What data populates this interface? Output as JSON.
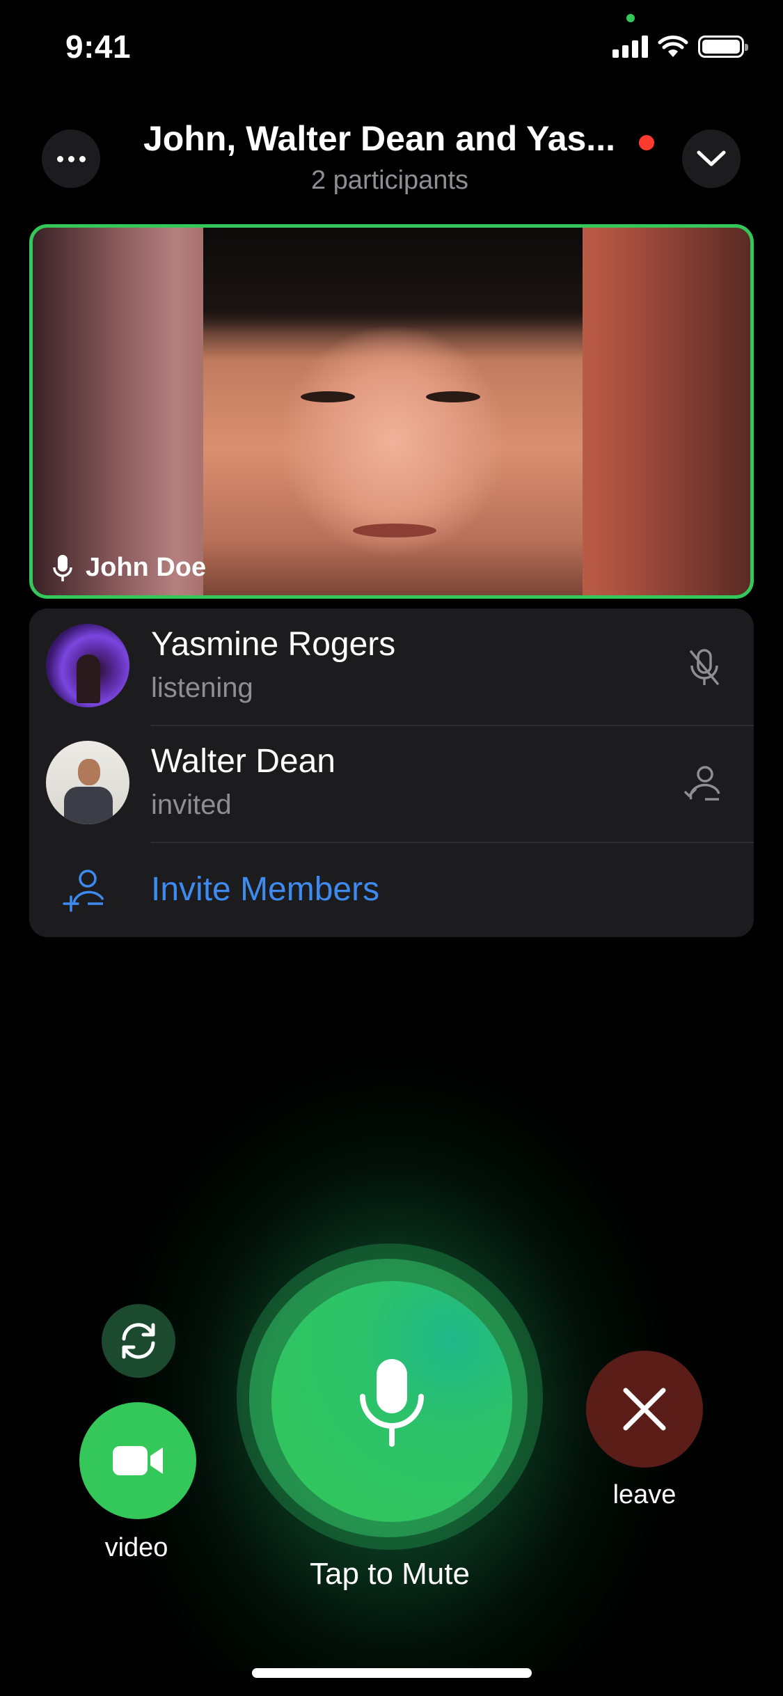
{
  "status_bar": {
    "time": "9:41"
  },
  "header": {
    "title": "John, Walter Dean and Yas...",
    "subtitle": "2 participants"
  },
  "video_tile": {
    "speaker_name": "John Doe"
  },
  "participants": [
    {
      "name": "Yasmine Rogers",
      "status": "listening",
      "icon": "mic-muted-icon"
    },
    {
      "name": "Walter Dean",
      "status": "invited",
      "icon": "person-check-icon"
    }
  ],
  "invite": {
    "label": "Invite Members"
  },
  "controls": {
    "video_label": "video",
    "mute_label": "Tap to Mute",
    "leave_label": "leave"
  },
  "colors": {
    "accent_green": "#34c759",
    "link_blue": "#3e8bf0",
    "record_red": "#ff3b30",
    "leave_bg": "#5a1d18"
  }
}
